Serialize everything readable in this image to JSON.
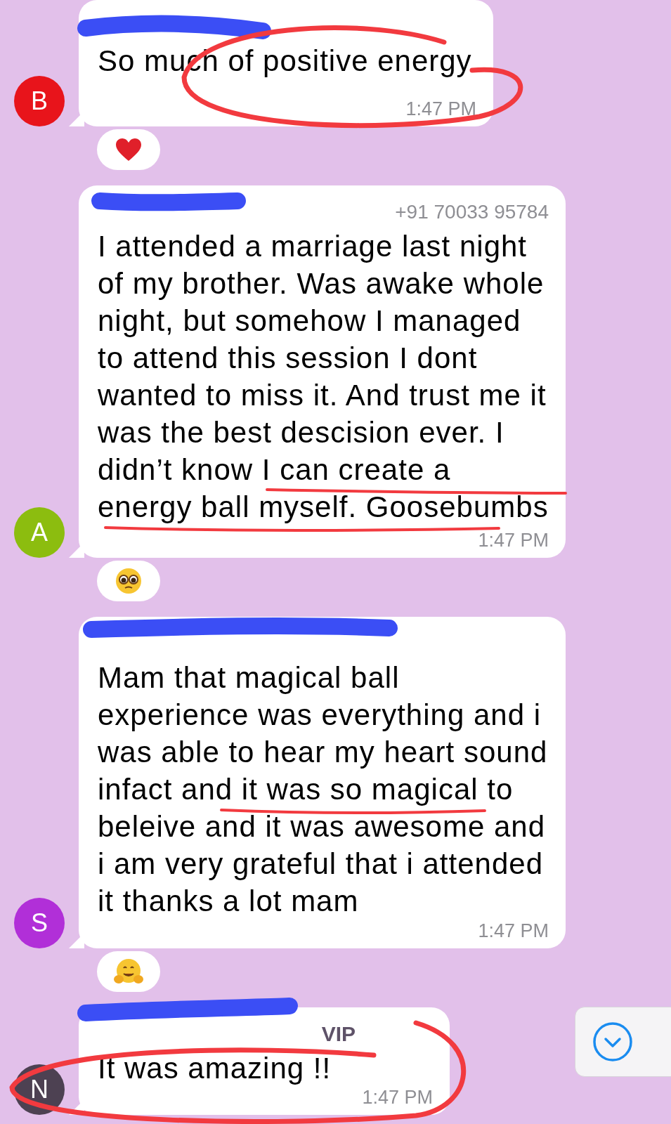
{
  "messages": [
    {
      "avatar": "B",
      "color": "#e8141b",
      "sender_redacted": true,
      "text": "So much of positive energy",
      "time": "1:47 PM",
      "annotations": [
        {
          "kind": "ellipse"
        }
      ],
      "reaction": {
        "kind": "heart"
      }
    },
    {
      "avatar": "A",
      "color": "#8cbd0f",
      "sender_redacted": true,
      "phone": "+91 70033 95784",
      "text": "I attended a marriage last night of my brother. Was awake whole night, but somehow I managed to attend this session I dont wanted to miss it. And trust me it was the best descision ever. I didn’t know I can create a energy ball myself. Goosebumbs",
      "time": "1:47 PM",
      "annotations": [
        {
          "kind": "underline"
        },
        {
          "kind": "underline"
        }
      ],
      "reaction": {
        "kind": "pleading"
      }
    },
    {
      "avatar": "S",
      "color": "#b12fd8",
      "sender_redacted": true,
      "text": "Mam that magical ball experience was everything and i was able to hear my heart sound infact and it was so magical to beleive and it was awesome and i am very grateful that i attended it thanks a lot mam",
      "time": "1:47 PM",
      "annotations": [
        {
          "kind": "underline"
        }
      ],
      "reaction": {
        "kind": "hug"
      }
    },
    {
      "avatar": "N",
      "color": "#4d4152",
      "sender_redacted": true,
      "sender_visible": "VIP",
      "text": "It was amazing !!",
      "time": "1:47 PM",
      "annotations": [
        {
          "kind": "ellipse"
        }
      ]
    }
  ],
  "scroll_button": {
    "kind": "scroll-down"
  }
}
